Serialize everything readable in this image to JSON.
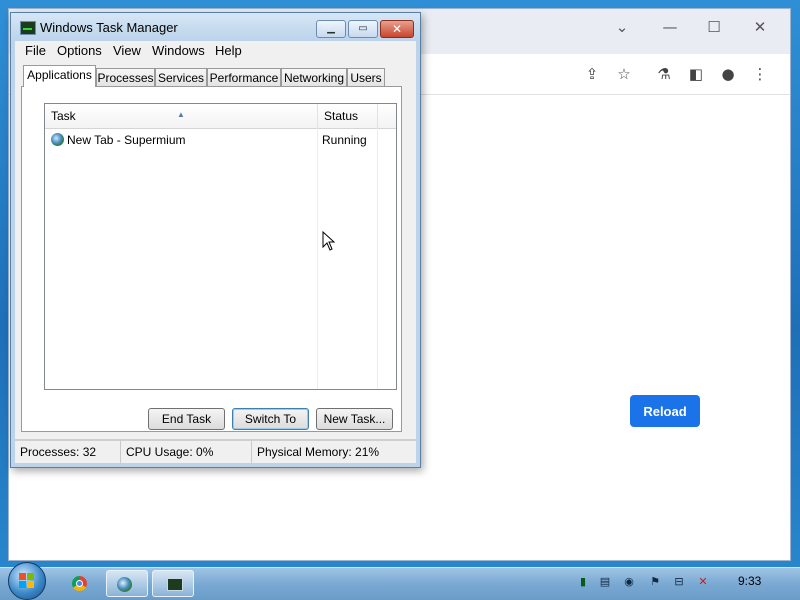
{
  "task_manager": {
    "title": "Windows Task Manager",
    "menu": [
      "File",
      "Options",
      "View",
      "Windows",
      "Help"
    ],
    "tabs": [
      "Applications",
      "Processes",
      "Services",
      "Performance",
      "Networking",
      "Users"
    ],
    "active_tab": "Applications",
    "columns": {
      "task": "Task",
      "status": "Status"
    },
    "rows": [
      {
        "task": "New Tab - Supermium",
        "status": "Running",
        "icon": "supermium-globe-icon"
      }
    ],
    "buttons": {
      "end_task": "End Task",
      "switch_to": "Switch To",
      "new_task": "New Task..."
    },
    "status_bar": {
      "processes": "Processes: 32",
      "cpu": "CPU Usage: 0%",
      "memory": "Physical Memory: 21%"
    }
  },
  "browser": {
    "reload_label": "Reload",
    "accent": "#1a73e8",
    "toolbar_icons": [
      "share-icon",
      "star-icon",
      "labs-icon",
      "side-panel-icon",
      "profile-icon",
      "menu-icon"
    ]
  },
  "taskbar": {
    "clock": "9:33",
    "pinned": [
      "chrome-icon",
      "supermium-icon",
      "task-manager-icon"
    ],
    "tray_icons": [
      "cpu-meter-icon",
      "notes-icon",
      "security-icon",
      "flag-icon",
      "network-icon",
      "volume-muted-icon"
    ]
  }
}
